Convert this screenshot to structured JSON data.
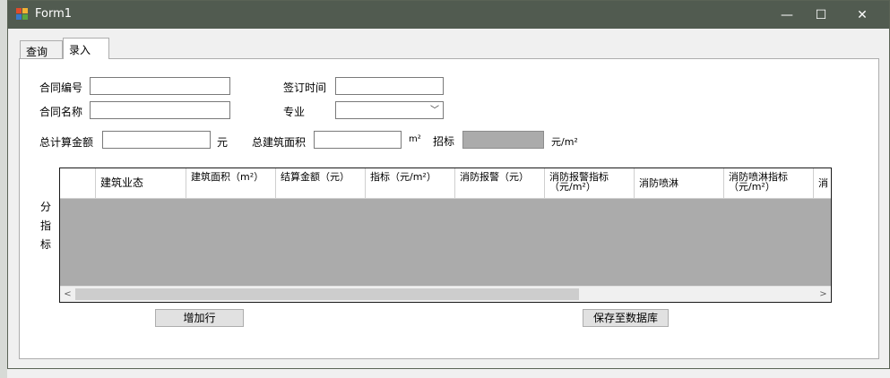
{
  "window": {
    "title": "Form1",
    "minimize": "—",
    "maximize": "☐",
    "close": "✕"
  },
  "tabs": [
    {
      "label": "查询"
    },
    {
      "label": "录入"
    }
  ],
  "form": {
    "contract_no_label": "合同编号",
    "contract_no_value": "",
    "sign_time_label": "签订时间",
    "sign_time_value": "",
    "contract_name_label": "合同名称",
    "contract_name_value": "",
    "major_label": "专业",
    "major_value": "",
    "total_amount_label": "总计算金额",
    "total_amount_value": "",
    "total_amount_unit": "元",
    "total_area_label": "总建筑面积",
    "total_area_value": "",
    "total_area_unit": "m²",
    "bid_label": "招标",
    "bid_value": "",
    "bid_unit": "元/m²"
  },
  "side_label": [
    "分",
    "指",
    "标"
  ],
  "grid": {
    "columns": [
      "",
      "建筑业态",
      "建筑面积（m²）",
      "结算金额（元）",
      "指标（元/m²）",
      "消防报警（元）",
      "消防报警指标（元/m²）",
      "消防喷淋",
      "消防喷淋指标（元/m²）",
      "消"
    ],
    "scroll_left": "<",
    "scroll_right": ">"
  },
  "buttons": {
    "add_row": "增加行",
    "save_db": "保存至数据库"
  }
}
